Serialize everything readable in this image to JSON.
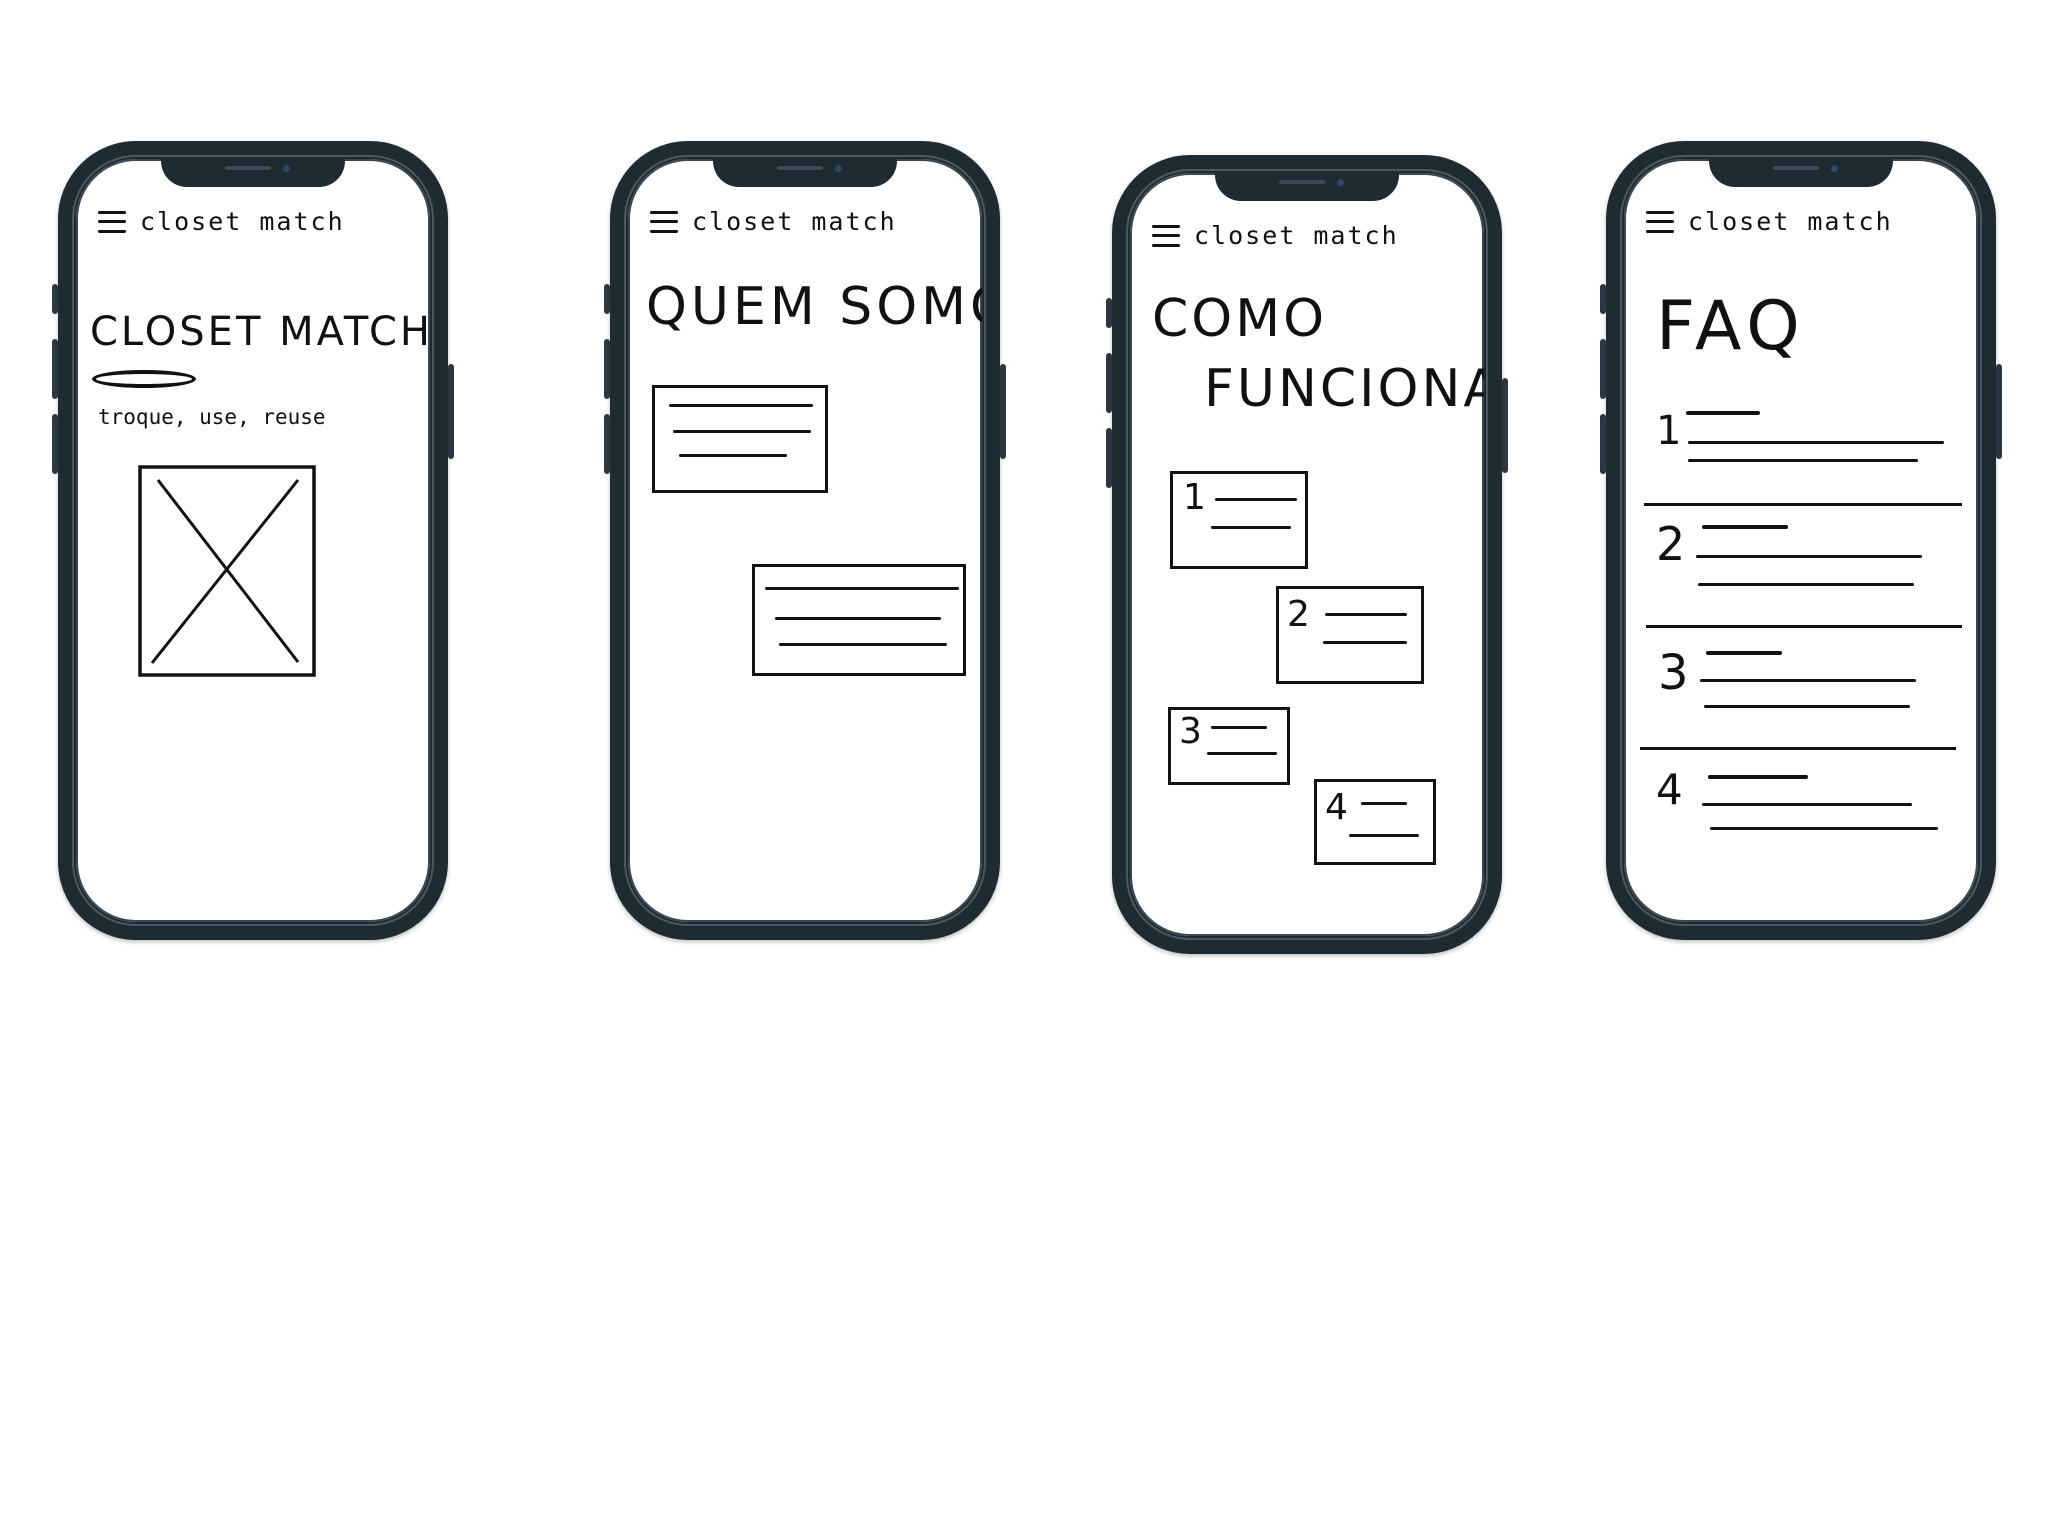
{
  "brand": "closet match",
  "screens": [
    {
      "id": "home",
      "title": "CLOSET MATCH",
      "tagline": "troque, use, reuse"
    },
    {
      "id": "about",
      "title": "QUEM SOMOS"
    },
    {
      "id": "how",
      "title_line1": "COMO",
      "title_line2": "FUNCIONA",
      "steps": [
        "1",
        "2",
        "3",
        "4"
      ]
    },
    {
      "id": "faq",
      "title": "FAQ",
      "items": [
        "1",
        "2",
        "3",
        "4"
      ]
    }
  ]
}
